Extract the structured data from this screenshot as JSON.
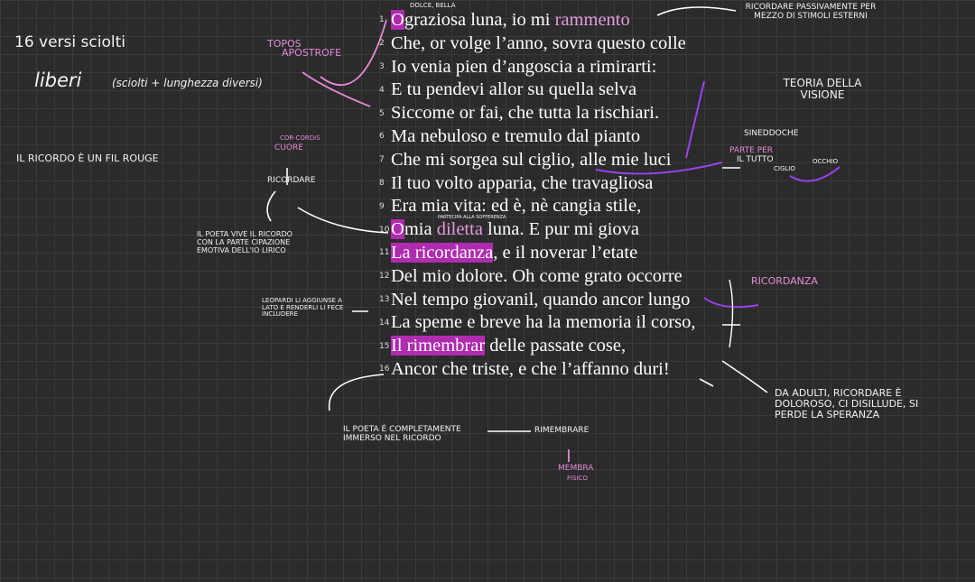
{
  "left_notes": {
    "title": "16 versi sciolti",
    "liberi": "liberi",
    "liberi_note": "(sciolti + lunghezza diversi)",
    "ricordo": "IL RICORDO È UN FIL ROUGE",
    "topos": "TOPOS",
    "apostrofe": "APOSTROFE",
    "cor_cordis": "COR-CORDIS",
    "cuore": "CUORE",
    "ricordare": "RICORDARE",
    "poeta_vive": "IL POETA VIVE IL RICORDO CON LA PARTE CIPAZIONE EMOTIVA DELL'IO LIRICO",
    "leopardi_note": "LEOPARDI LI AGGIUNSE A LATO E RENDERLI LI FECE INCLUDERE"
  },
  "poem": {
    "top_note": "DOLCE, BELLA",
    "mid_note": "PARTECIPA ALLA SOFFERENZA",
    "lines": [
      {
        "n": "1",
        "pre": "",
        "hl": "O",
        "a": "graziosa luna, io mi ",
        "hl2": "rammento",
        "b": ""
      },
      {
        "n": "2",
        "pre": "Che, or volge l’anno, sovra questo colle",
        "hl": "",
        "a": "",
        "hl2": "",
        "b": ""
      },
      {
        "n": "3",
        "pre": "Io venia pien d’angoscia a rimirarti:",
        "hl": "",
        "a": "",
        "hl2": "",
        "b": ""
      },
      {
        "n": "4",
        "pre": "E tu pendevi allor su quella selva",
        "hl": "",
        "a": "",
        "hl2": "",
        "b": ""
      },
      {
        "n": "5",
        "pre": "Siccome or fai, che tutta la rischiari.",
        "hl": "",
        "a": "",
        "hl2": "",
        "b": ""
      },
      {
        "n": "6",
        "pre": "Ma nebuloso e tremulo dal pianto",
        "hl": "",
        "a": "",
        "hl2": "",
        "b": ""
      },
      {
        "n": "7",
        "pre": "Che mi sorgea sul ciglio, alle mie luci",
        "hl": "",
        "a": "",
        "hl2": "",
        "b": ""
      },
      {
        "n": "8",
        "pre": "Il tuo volto apparia, che travagliosa",
        "hl": "",
        "a": "",
        "hl2": "",
        "b": ""
      },
      {
        "n": "9",
        "pre": "Era mia vita: ed è, nè cangia stile,",
        "hl": "",
        "a": "",
        "hl2": "",
        "b": ""
      },
      {
        "n": "10",
        "pre": "",
        "hl": "O",
        "a": "mia ",
        "hl2": "diletta",
        "b": " luna. E pur mi giova"
      },
      {
        "n": "11",
        "pre": "",
        "hl": "La ricordanza",
        "a": ", e il noverar l’etate",
        "hl2": "",
        "b": ""
      },
      {
        "n": "12",
        "pre": "Del mio dolore. Oh come grato occorre",
        "hl": "",
        "a": "",
        "hl2": "",
        "b": ""
      },
      {
        "n": "13",
        "pre": "Nel tempo giovanil, quando ancor lungo",
        "hl": "",
        "a": "",
        "hl2": "",
        "b": ""
      },
      {
        "n": "14",
        "pre": "La speme e breve ha la memoria il corso,",
        "hl": "",
        "a": "",
        "hl2": "",
        "b": ""
      },
      {
        "n": "15",
        "pre": "",
        "hl": "Il rimembrar",
        "a": " delle passate cose,",
        "hl2": "",
        "b": ""
      },
      {
        "n": "16",
        "pre": "Ancor che triste, e che l’affanno duri!",
        "hl": "",
        "a": "",
        "hl2": "",
        "b": ""
      }
    ]
  },
  "right_notes": {
    "ricordare_passiv": "RICORDARE PASSIVAMENTE PER MEZZO DI STIMOLI ESTERNI",
    "teoria": "TEORIA DELLA VISIONE",
    "sineddoche": "SINEDDOCHE",
    "parte_per": "PARTE PER",
    "il_tutto": "IL TUTTO",
    "ciglio": "CIGLIO",
    "occhio": "OCCHIO",
    "ricordanza": "RICORDANZA",
    "adulti": "DA ADULTI, RICORDARE È DOLOROSO, CI DISILLUDE, SI PERDE LA SPERANZA"
  },
  "bottom_notes": {
    "poeta_immerso": "IL POETA È COMPLETAMENTE IMMERSO NEL RICORDO",
    "rimembrare": "RIMEMBRARE",
    "membra": "MEMBRA",
    "fisico": "FISICO"
  },
  "colors": {
    "background": "#2b2b2b",
    "grid": "#3a3a3a",
    "highlight": "#b02bb0",
    "pink": "#e48ad8",
    "purple": "#9b40f0"
  }
}
